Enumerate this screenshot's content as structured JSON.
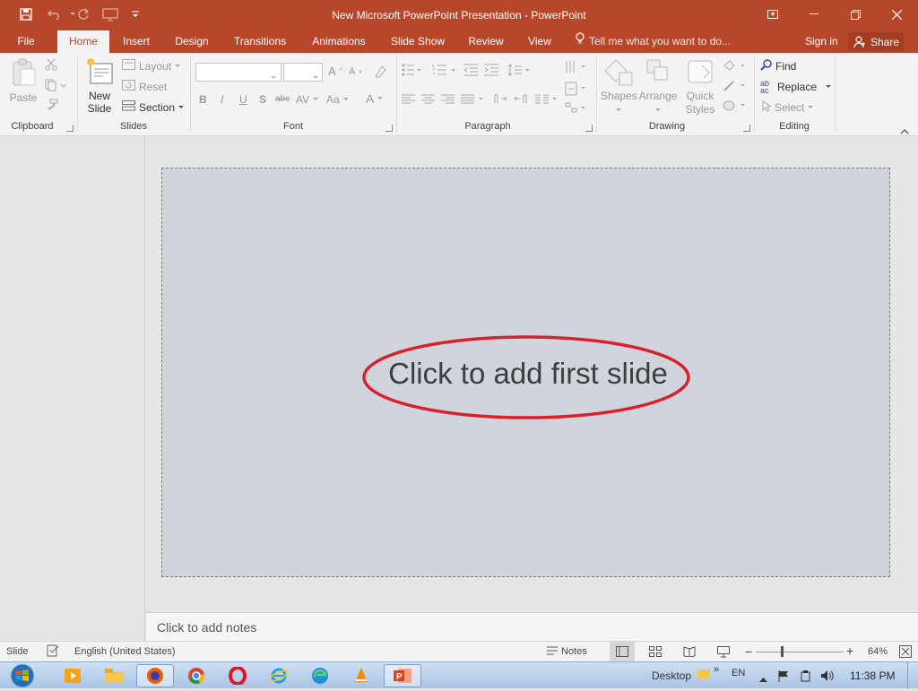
{
  "titlebar": {
    "title": "New Microsoft PowerPoint Presentation - PowerPoint",
    "bg_color": "#b7472a"
  },
  "tabs": {
    "file": "File",
    "home": "Home",
    "insert": "Insert",
    "design": "Design",
    "transitions": "Transitions",
    "animations": "Animations",
    "slideshow": "Slide Show",
    "review": "Review",
    "view": "View",
    "tell_me": "Tell me what you want to do...",
    "signin": "Sign in",
    "share": "Share"
  },
  "ribbon": {
    "clipboard": {
      "label": "Clipboard",
      "paste": "Paste"
    },
    "slides": {
      "label": "Slides",
      "new_slide_1": "New",
      "new_slide_2": "Slide",
      "layout": "Layout",
      "reset": "Reset",
      "section": "Section"
    },
    "font": {
      "label": "Font",
      "bold": "B",
      "italic": "I",
      "underline": "U",
      "shadow": "S",
      "strike": "abc",
      "spacing": "AV",
      "case": "Aa",
      "color": "A"
    },
    "paragraph": {
      "label": "Paragraph"
    },
    "drawing": {
      "label": "Drawing",
      "shapes": "Shapes",
      "arrange": "Arrange",
      "quick_styles_1": "Quick",
      "quick_styles_2": "Styles"
    },
    "editing": {
      "label": "Editing",
      "find": "Find",
      "replace": "Replace",
      "select": "Select"
    }
  },
  "slide": {
    "placeholder": "Click to add first slide",
    "highlight_color": "#d9212b"
  },
  "notes": {
    "placeholder": "Click to add notes"
  },
  "status": {
    "slide": "Slide",
    "language": "English (United States)",
    "notes": "Notes",
    "zoom": "64%"
  },
  "taskbar": {
    "desktop": "Desktop",
    "lang": "EN",
    "time": "11:38 PM"
  }
}
